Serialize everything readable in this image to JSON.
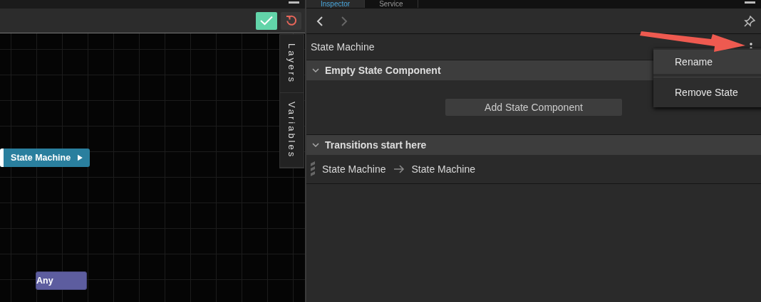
{
  "editor": {
    "side_tabs": [
      "Layers",
      "Variables"
    ],
    "nodes": [
      {
        "label": "State Machine",
        "kind": "state"
      },
      {
        "label": "Any",
        "kind": "any"
      }
    ]
  },
  "inspector": {
    "tabs": [
      {
        "label": "Inspector",
        "selected": true
      },
      {
        "label": "Service",
        "selected": false
      }
    ],
    "title": "State Machine",
    "sections": [
      {
        "title": "Empty State Component",
        "expanded": true,
        "button": "Add State Component"
      },
      {
        "title": "Transitions start here",
        "expanded": true,
        "transitions": [
          {
            "from": "State Machine",
            "to": "State Machine"
          }
        ]
      }
    ],
    "context_menu": [
      {
        "label": "Rename",
        "selected": true
      },
      {
        "label": "Remove State",
        "selected": false
      }
    ]
  }
}
